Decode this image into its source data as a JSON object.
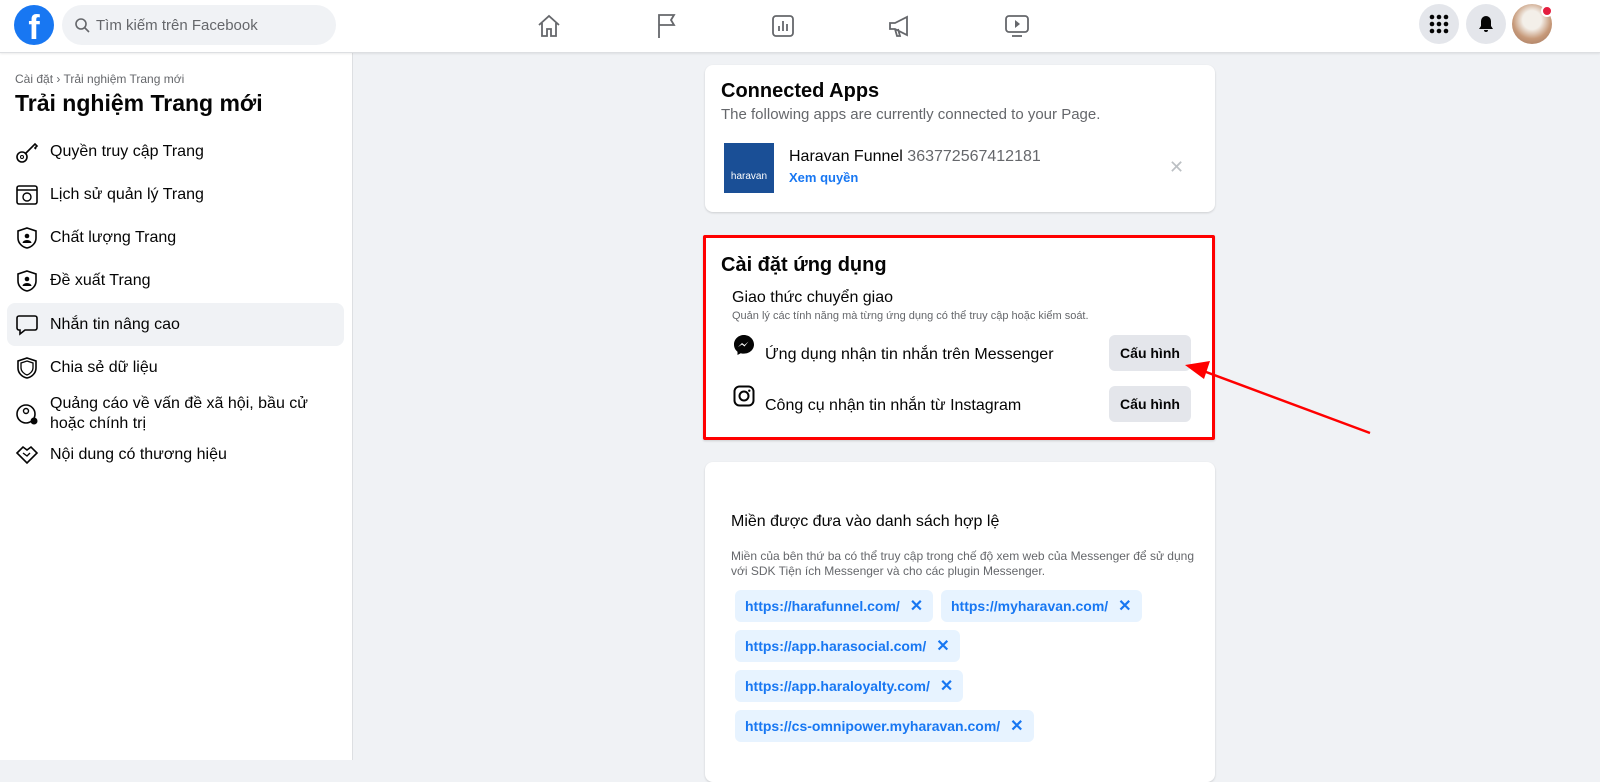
{
  "header": {
    "logo": "f",
    "search_placeholder": "Tìm kiếm trên Facebook",
    "nav": [
      "home-icon",
      "pages-flag-icon",
      "insights-icon",
      "ads-megaphone-icon",
      "watch-icon"
    ]
  },
  "sidebar": {
    "breadcrumb": "Cài đặt › Trải nghiệm Trang mới",
    "title": "Trải nghiệm Trang mới",
    "items": [
      {
        "label": "Quyền truy cập Trang",
        "icon": "key-icon"
      },
      {
        "label": "Lịch sử quản lý Trang",
        "icon": "history-icon"
      },
      {
        "label": "Chất lượng Trang",
        "icon": "shield-person-icon"
      },
      {
        "label": "Đề xuất Trang",
        "icon": "shield-person-icon"
      },
      {
        "label": "Nhắn tin nâng cao",
        "icon": "chat-bubble-icon",
        "active": true
      },
      {
        "label": "Chia sẻ dữ liệu",
        "icon": "shield-icon"
      },
      {
        "label": "Quảng cáo về vấn đề xã hội, bầu cử hoặc chính trị",
        "icon": "person-gear-icon"
      },
      {
        "label": "Nội dung có thương hiệu",
        "icon": "handshake-icon"
      }
    ]
  },
  "connected": {
    "title": "Connected Apps",
    "subtitle": "The following apps are currently connected to your Page.",
    "app": {
      "logo_text": "haravan",
      "name": "Haravan Funnel",
      "id": "363772567412181",
      "link": "Xem quyền"
    }
  },
  "app_settings": {
    "title": "Cài đặt ứng dụng",
    "section": "Giao thức chuyển giao",
    "description": "Quản lý các tính năng mà từng ứng dụng có thể truy cập hoặc kiểm soát.",
    "rows": [
      {
        "label": "Ứng dụng nhận tin nhắn trên Messenger",
        "button": "Cấu hình",
        "icon": "messenger-icon"
      },
      {
        "label": "Công cụ nhận tin nhắn từ Instagram",
        "button": "Cấu hình",
        "icon": "instagram-icon"
      }
    ],
    "highlight_color": "#ff0000"
  },
  "whitelist": {
    "title": "Miền được đưa vào danh sách hợp lệ",
    "description": "Miền của bên thứ ba có thể truy cập trong chế độ xem web của Messenger để sử dụng với SDK Tiện ích Messenger và cho các plugin Messenger.",
    "domains": [
      "https://harafunnel.com/",
      "https://myharavan.com/",
      "https://app.harasocial.com/",
      "https://app.haraloyalty.com/",
      "https://cs-omnipower.myharavan.com/"
    ],
    "remove": "✕"
  }
}
